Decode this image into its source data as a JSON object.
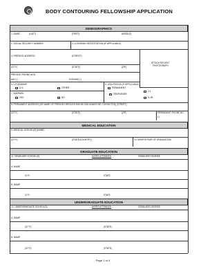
{
  "document": {
    "title": "BODY CONTOURING FELLOWSHIP APPLICATION",
    "footer": "Page 1 of 4"
  },
  "demographics": {
    "header": "DEMOGRAPHICS",
    "name_label": "1.  NAME",
    "last": "(LAST)",
    "first": "(FIRST)",
    "middle": "(MIDDLE)",
    "ssn": "2.  SOCIAL SECURITY NUMBER",
    "reg": "3.  LICENSING REGISTRATION (IF APPLICABLE)",
    "address": "4.  PRESENT ADDRESS",
    "street": "(STREET)",
    "city": "(CITY)",
    "state": "(STATE)",
    "zip": "(ZIP)",
    "photo_line1": "ATTACH RECENT",
    "photo_line2": "PHOTOGRAPH",
    "phone": "PRESENT PHONE NOS.",
    "day": "DAY (       )",
    "evening": "EVENING (       )",
    "citizenship": "5.  CITIZENSHIP",
    "us": "U.S.",
    "other": "OTHER",
    "visa": "6.  VISA STATUS (IF APPLICABLE)",
    "permanent": "PERMANENT",
    "temporary": "TEMPORARY",
    "j1": "J-1",
    "h1b": "H-1B",
    "married": "7.  MARRIED",
    "yes": "YES",
    "no": "NO",
    "perm_address": "8.  PERMANENT ADDRESS (OR NAME OF PERSON THROUGH WHOM CAN ALWAYS BE CONTACTED)    (STREET)",
    "perm_phone": "PERMANENT PHONE NO.",
    "perm_phone_paren": "(        )"
  },
  "medical": {
    "header": "MEDICAL EDUCATION",
    "school": "9.  MEDICAL SCHOOL(S)    (NAME)",
    "city": "(CITY)",
    "state_country": "(STATE/COUNTRY)",
    "graduation": "10.  MONTH/YEAR OF GRADUATION"
  },
  "graduate": {
    "header": "GRADUATE EDUCATION",
    "schools": "11.  GRADUATE SCHOOL(S)",
    "dates": "DATES ATTENDED",
    "degree": "GRADUATE DEGREE",
    "a_name": "A.  NAME",
    "a_city": "CITY",
    "a_state": "STATE",
    "b_name": "B.  NAME",
    "b_city": "CITY",
    "b_state": "STATE"
  },
  "undergraduate": {
    "header": "UNDERGRADUATE EDUCATION",
    "schools": "12.  UNDERGRADUATE SCHOOL(S)",
    "dates": "DATES ATTENDED",
    "degree": "GRADUATE DEGREE",
    "a_name": "A.  NAME",
    "a_city": "(CITY)",
    "a_state": "(STATE)",
    "b_name": "B.  NAME",
    "b_city": "(CITY)",
    "b_state": "(STATE)"
  }
}
